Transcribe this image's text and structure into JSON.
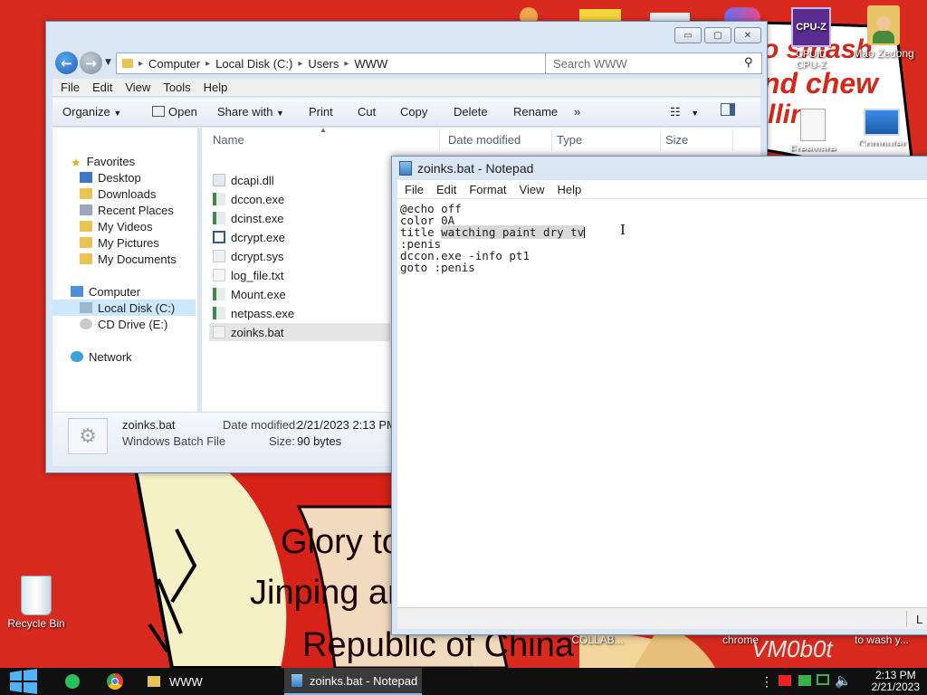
{
  "desktop": {
    "wallpaper_texts": [
      "o smash",
      "nd chew",
      "llin",
      "Glory to",
      "Jinping ar",
      "Republic of China",
      "VM0b0t"
    ],
    "icons": [
      {
        "label": "CPUID CPU-Z",
        "icon": "cpu-z-icon"
      },
      {
        "label": "Mao Zedong",
        "icon": "user-folder-icon"
      },
      {
        "label": "Freeware",
        "icon": "document-icon"
      },
      {
        "label": "Computer",
        "icon": "computer-icon"
      },
      {
        "label": "Recycle Bin",
        "icon": "recycle-bin-icon"
      },
      {
        "label": "COLLAB...",
        "icon": "app-icon"
      },
      {
        "label": "chrome",
        "icon": "chrome-icon"
      },
      {
        "label": "to wash y...",
        "icon": "document-icon"
      }
    ],
    "cpuz_badge": "CPU-Z"
  },
  "explorer": {
    "window_buttons": {
      "minimize": "▭",
      "maximize": "▢",
      "close": "✕"
    },
    "breadcrumb": [
      "Computer",
      "Local Disk (C:)",
      "Users",
      "WWW"
    ],
    "search_placeholder": "Search WWW",
    "menu": [
      "File",
      "Edit",
      "View",
      "Tools",
      "Help"
    ],
    "commands": {
      "organize": "Organize",
      "open": "Open",
      "share": "Share with",
      "print": "Print",
      "cut": "Cut",
      "copy": "Copy",
      "delete": "Delete",
      "rename": "Rename",
      "more": "»"
    },
    "nav": {
      "favorites": "Favorites",
      "favorites_items": [
        "Desktop",
        "Downloads",
        "Recent Places",
        "My Videos",
        "My Pictures",
        "My Documents"
      ],
      "computer": "Computer",
      "computer_items": [
        "Local Disk (C:)",
        "CD Drive (E:)"
      ],
      "network": "Network"
    },
    "columns": {
      "name": "Name",
      "date": "Date modified",
      "type": "Type",
      "size": "Size"
    },
    "files": [
      {
        "name": "dcapi.dll",
        "icon": "dll-icon"
      },
      {
        "name": "dccon.exe",
        "icon": "exe-icon"
      },
      {
        "name": "dcinst.exe",
        "icon": "exe-icon"
      },
      {
        "name": "dcrypt.exe",
        "icon": "dcrypt-icon"
      },
      {
        "name": "dcrypt.sys",
        "icon": "sys-icon"
      },
      {
        "name": "log_file.txt",
        "icon": "txt-icon"
      },
      {
        "name": "Mount.exe",
        "icon": "exe-icon"
      },
      {
        "name": "netpass.exe",
        "icon": "exe-icon"
      },
      {
        "name": "zoinks.bat",
        "icon": "bat-icon"
      }
    ],
    "details": {
      "name": "zoinks.bat",
      "type": "Windows Batch File",
      "date_label": "Date modified:",
      "date_value": "2/21/2023 2:13 PM",
      "size_label": "Size:",
      "size_value": "90 bytes"
    }
  },
  "notepad": {
    "title": "zoinks.bat - Notepad",
    "menu": [
      "File",
      "Edit",
      "Format",
      "View",
      "Help"
    ],
    "lines": [
      {
        "pre": "@echo off",
        "hl": "",
        "post": ""
      },
      {
        "pre": "color 0A",
        "hl": "",
        "post": ""
      },
      {
        "pre": "title ",
        "hl": "watching paint dry tv",
        "post": ""
      },
      {
        "pre": ":penis",
        "hl": "",
        "post": ""
      },
      {
        "pre": "dccon.exe -info pt1",
        "hl": "",
        "post": ""
      },
      {
        "pre": "goto :penis",
        "hl": "",
        "post": ""
      }
    ],
    "status_fragment": "L"
  },
  "taskbar": {
    "tasks": [
      {
        "label": "WWW",
        "icon": "folder-icon"
      },
      {
        "label": "zoinks.bat - Notepad",
        "icon": "notepad-icon"
      }
    ],
    "time": "2:13 PM",
    "date": "2/21/2023"
  }
}
